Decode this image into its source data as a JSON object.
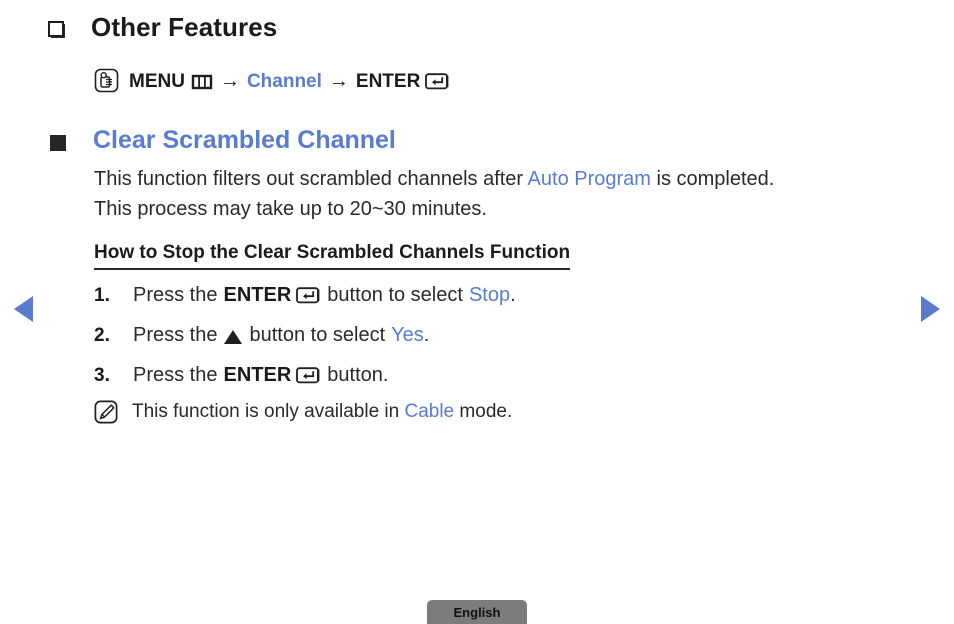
{
  "page": {
    "background": "#ffffff",
    "accent_blue": "#5a7ccb",
    "text_color": "#2a2a2a"
  },
  "nav": {
    "prev_label": "◀",
    "next_label": "▶",
    "prev_icon": "triangle-left-icon",
    "next_icon": "triangle-right-icon"
  },
  "section": {
    "title": "Other Features",
    "bullet_icon": "outlined-square-bullet-icon"
  },
  "menu_path": {
    "press_icon": "hand-press-button-icon",
    "menu_label": "MENU",
    "grid_icon": "menu-grid-icon",
    "arrow1": "→",
    "channel_label": "Channel",
    "arrow2": "→",
    "enter_label": "ENTER",
    "enter_icon": "enter-return-icon"
  },
  "topic": {
    "bullet_icon": "filled-square-bullet-icon",
    "title": "Clear Scrambled Channel",
    "paragraph_pre": "This function filters out scrambled channels after ",
    "paragraph_highlight": "Auto Program",
    "paragraph_post": " is completed.",
    "paragraph_line2": "This process may take up to 20~30 minutes."
  },
  "subhead": {
    "text": "How to Stop the Clear Scrambled Channels Function"
  },
  "steps": [
    {
      "number": "1.",
      "pre": "Press the",
      "key": "ENTER",
      "key_icon": "enter-return-icon",
      "mid": "button to select",
      "highlight": "Stop",
      "post": "."
    },
    {
      "number": "2.",
      "pre": "Press the",
      "key": "",
      "key_icon": "triangle-up-icon",
      "mid": "button to select",
      "highlight": "Yes",
      "post": "."
    },
    {
      "number": "3.",
      "pre": "Press the",
      "key": "ENTER",
      "key_icon": "enter-return-icon",
      "mid": "button.",
      "highlight": "",
      "post": ""
    }
  ],
  "note": {
    "icon": "note-pencil-icon",
    "pre": "This function is only available in ",
    "highlight": "Cable",
    "post": " mode."
  },
  "footer": {
    "language": "English"
  }
}
